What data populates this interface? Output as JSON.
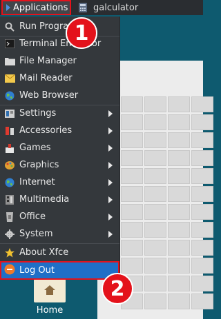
{
  "panel": {
    "applications_label": "Applications",
    "task_label": "galculator"
  },
  "menu": {
    "items": [
      {
        "label": "Run Program...",
        "icon": "run-icon",
        "submenu": false
      },
      {
        "label": "Terminal Emulator",
        "icon": "terminal-icon",
        "submenu": false
      },
      {
        "label": "File Manager",
        "icon": "folder-icon",
        "submenu": false
      },
      {
        "label": "Mail Reader",
        "icon": "mail-icon",
        "submenu": false
      },
      {
        "label": "Web Browser",
        "icon": "globe-icon",
        "submenu": false
      },
      {
        "label": "Settings",
        "icon": "settings-icon",
        "submenu": true
      },
      {
        "label": "Accessories",
        "icon": "accessories-icon",
        "submenu": true
      },
      {
        "label": "Games",
        "icon": "games-icon",
        "submenu": true
      },
      {
        "label": "Graphics",
        "icon": "graphics-icon",
        "submenu": true
      },
      {
        "label": "Internet",
        "icon": "globe-icon",
        "submenu": true
      },
      {
        "label": "Multimedia",
        "icon": "multimedia-icon",
        "submenu": true
      },
      {
        "label": "Office",
        "icon": "office-icon",
        "submenu": true
      },
      {
        "label": "System",
        "icon": "gear-icon",
        "submenu": true
      },
      {
        "label": "About Xfce",
        "icon": "star-icon",
        "submenu": false
      }
    ],
    "logout_label": "Log Out"
  },
  "desktop": {
    "home_label": "Home"
  },
  "annotations": {
    "badge1": "1",
    "badge2": "2"
  },
  "colors": {
    "highlight": "#1f6fc7",
    "annotation": "#e4121b",
    "desktop": "#0e5a6f"
  }
}
